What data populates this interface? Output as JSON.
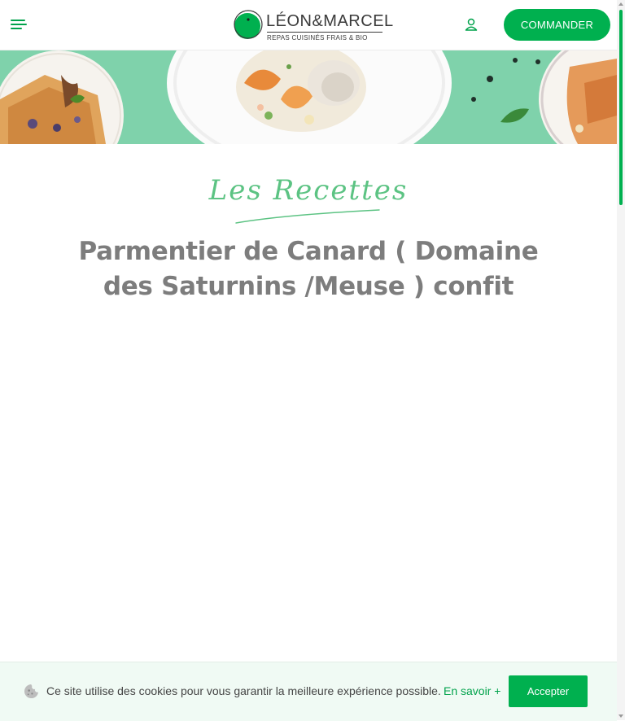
{
  "header": {
    "menu_icon": "hamburger-menu-icon",
    "logo": {
      "name": "LÉON&MARCEL",
      "tagline": "REPAS CUISINÉS FRAIS & BIO"
    },
    "account_icon": "user-icon",
    "cta_label": "COMMANDER"
  },
  "banner": {
    "background_color": "#7fd2ab"
  },
  "main": {
    "section_label": "Les Recettes",
    "recipe_title": "Parmentier de Canard ( Domaine des Saturnins /Meuse ) confit"
  },
  "cookie": {
    "icon": "cookie-icon",
    "message": "Ce site utilise des cookies pour vous garantir la meilleure expérience possible.",
    "more_link": "En savoir +",
    "accept_label": "Accepter"
  },
  "colors": {
    "brand_green": "#00b04f",
    "script_green": "#5cc383",
    "title_gray": "#7d7d7d"
  }
}
